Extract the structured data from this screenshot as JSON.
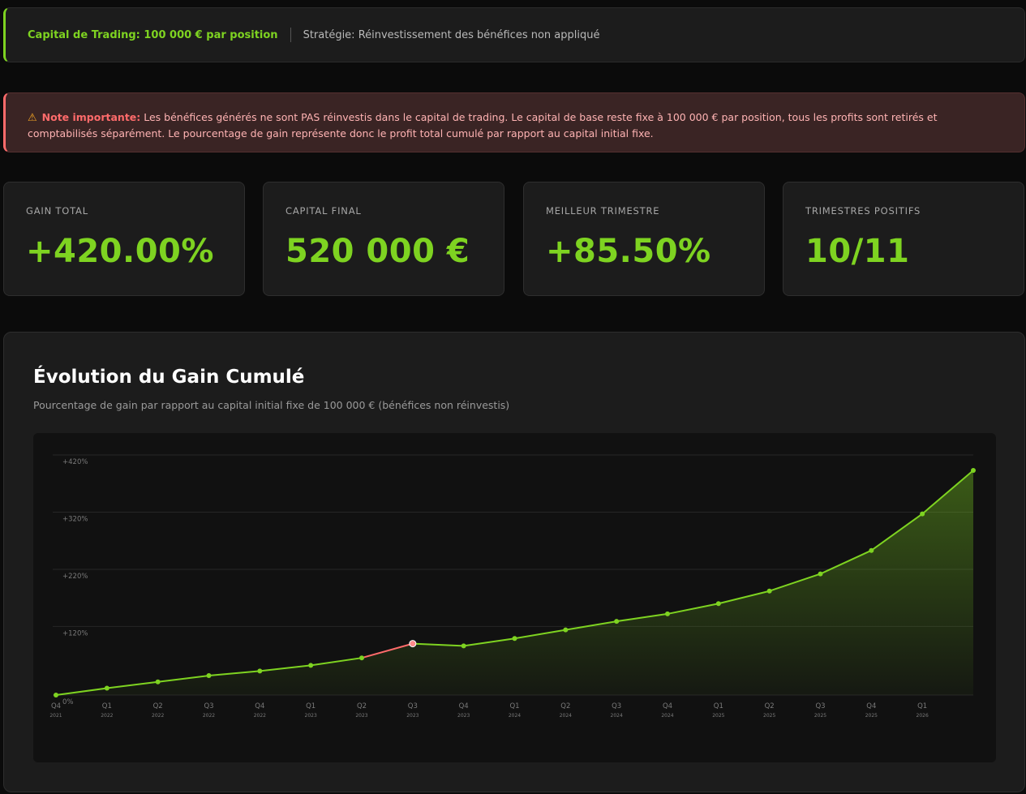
{
  "info_bar": {
    "capital": "Capital de Trading: 100 000 € par position",
    "strategy": "Stratégie: Réinvestissement des bénéfices non appliqué"
  },
  "note": {
    "icon": "warning-icon",
    "title": "Note importante:",
    "text": " Les bénéfices générés ne sont PAS réinvestis dans le capital de trading. Le capital de base reste fixe à 100 000 € par position, tous les profits sont retirés et comptabilisés séparément. Le pourcentage de gain représente donc le profit total cumulé par rapport au capital initial fixe."
  },
  "stats": [
    {
      "label": "GAIN TOTAL",
      "value": "+420.00%"
    },
    {
      "label": "CAPITAL FINAL",
      "value": "520 000 €"
    },
    {
      "label": "MEILLEUR TRIMESTRE",
      "value": "+85.50%"
    },
    {
      "label": "TRIMESTRES POSITIFS",
      "value": "10/11"
    }
  ],
  "chart": {
    "title": "Évolution du Gain Cumulé",
    "subtitle": "Pourcentage de gain par rapport au capital initial fixe de 100 000 € (bénéfices non réinvestis)"
  },
  "colors": {
    "accent": "#7ed321",
    "negative": "#ff6b6b",
    "negative_point": "#ff8a8a"
  },
  "chart_data": {
    "type": "area",
    "x": [
      [
        "Q4",
        "2021"
      ],
      [
        "Q1",
        "2022"
      ],
      [
        "Q2",
        "2022"
      ],
      [
        "Q3",
        "2022"
      ],
      [
        "Q4",
        "2022"
      ],
      [
        "Q1",
        "2023"
      ],
      [
        "Q2",
        "2023"
      ],
      [
        "Q3",
        "2023"
      ],
      [
        "Q4",
        "2023"
      ],
      [
        "Q1",
        "2024"
      ],
      [
        "Q2",
        "2024"
      ],
      [
        "Q3",
        "2024"
      ],
      [
        "Q4",
        "2024"
      ],
      [
        "Q1",
        "2025"
      ],
      [
        "Q2",
        "2025"
      ],
      [
        "Q3",
        "2025"
      ],
      [
        "Q4",
        "2025"
      ],
      [
        "Q1",
        "2026"
      ],
      [
        "",
        ""
      ]
    ],
    "values": [
      0,
      12,
      23,
      34,
      42,
      52,
      65,
      90,
      86,
      99,
      114,
      129,
      142,
      160,
      182,
      212,
      253,
      317,
      393
    ],
    "y_ticks": [
      "0%",
      "+120%",
      "+220%",
      "+320%",
      "+420%"
    ],
    "y_tick_values": [
      0,
      120,
      220,
      320,
      420
    ],
    "ylim": [
      0,
      420
    ],
    "grid": true,
    "negative_segments": [
      [
        6,
        7
      ]
    ],
    "negative_points": [
      7
    ]
  }
}
